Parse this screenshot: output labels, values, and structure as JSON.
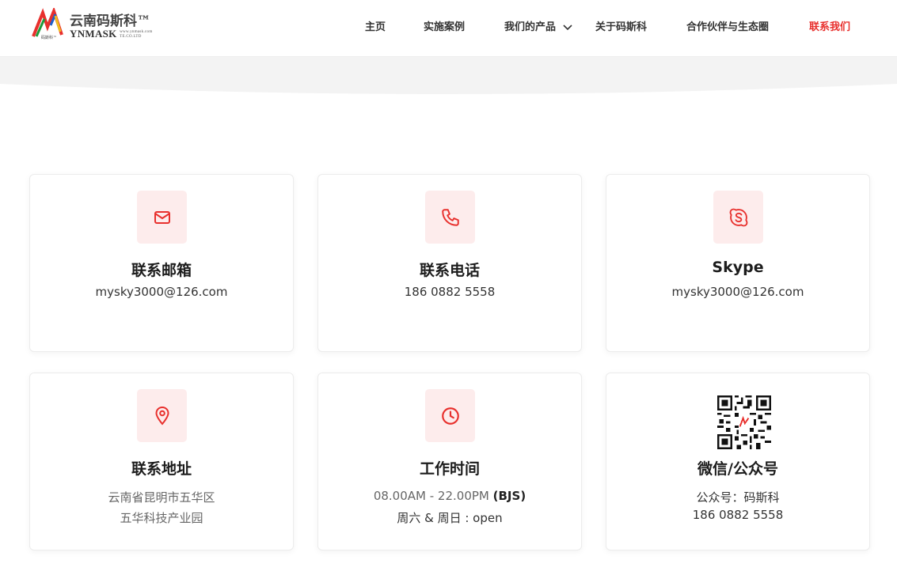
{
  "header": {
    "logo": {
      "cn_name": "云南码斯科™",
      "en_name": "YNMASK",
      "en_small": "www.ynmask.com TE.CO.LTD",
      "sub": "码斯科™"
    },
    "nav": [
      {
        "label": "主页"
      },
      {
        "label": "实施案例"
      },
      {
        "label": "我们的产品"
      },
      {
        "label": "关于码斯科"
      },
      {
        "label": "合作伙伴与生态圈"
      },
      {
        "label": "联系我们"
      }
    ]
  },
  "cards": {
    "email": {
      "title": "联系邮箱",
      "value": "mysky3000@126.com",
      "icon": "mail-icon"
    },
    "phone": {
      "title": "联系电话",
      "value": "186 0882 5558",
      "icon": "phone-icon"
    },
    "skype": {
      "title": "Skype",
      "value": "mysky3000@126.com",
      "icon": "skype-icon"
    },
    "address": {
      "title": "联系地址",
      "line1": "云南省昆明市五华区",
      "line2": "五华科技产业园",
      "icon": "map-pin-icon"
    },
    "hours": {
      "title": "工作时间",
      "line1": "08.00AM - 22.00PM",
      "line1_bold": "(BJS)",
      "line2": "周六 & 周日 : open",
      "icon": "clock-icon"
    },
    "wechat": {
      "title": "微信/公众号",
      "line1": "公众号：码斯科",
      "line2": "186 0882 5558",
      "icon": "qr-code-icon"
    }
  },
  "colors": {
    "accent": "#e8302d",
    "icon_bg": "#fdecec"
  }
}
